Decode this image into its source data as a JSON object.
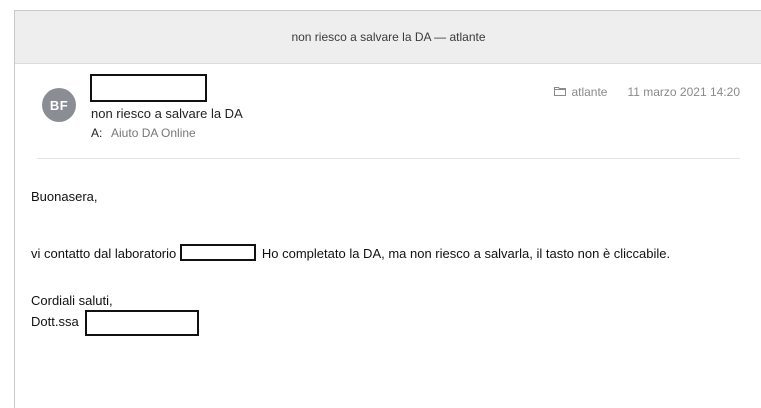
{
  "window": {
    "title": "non riesco a salvare la DA — atlante"
  },
  "header": {
    "avatar_initials": "BF",
    "avatar_color": "#8b8d95",
    "subject": "non riesco a salvare la DA",
    "to_label": "A:",
    "to_value": "Aiuto DA Online",
    "folder_icon": "folder-icon",
    "folder": "atlante",
    "date": "11 marzo 2021 14:20"
  },
  "body": {
    "greeting": "Buonasera,",
    "message_part1": "vi contatto dal laboratorio",
    "message_part2": "Ho completato la DA, ma non riesco a salvarla, il tasto non è cliccabile.",
    "closing": "Cordiali saluti,",
    "signature_prefix": "Dott.ssa"
  }
}
